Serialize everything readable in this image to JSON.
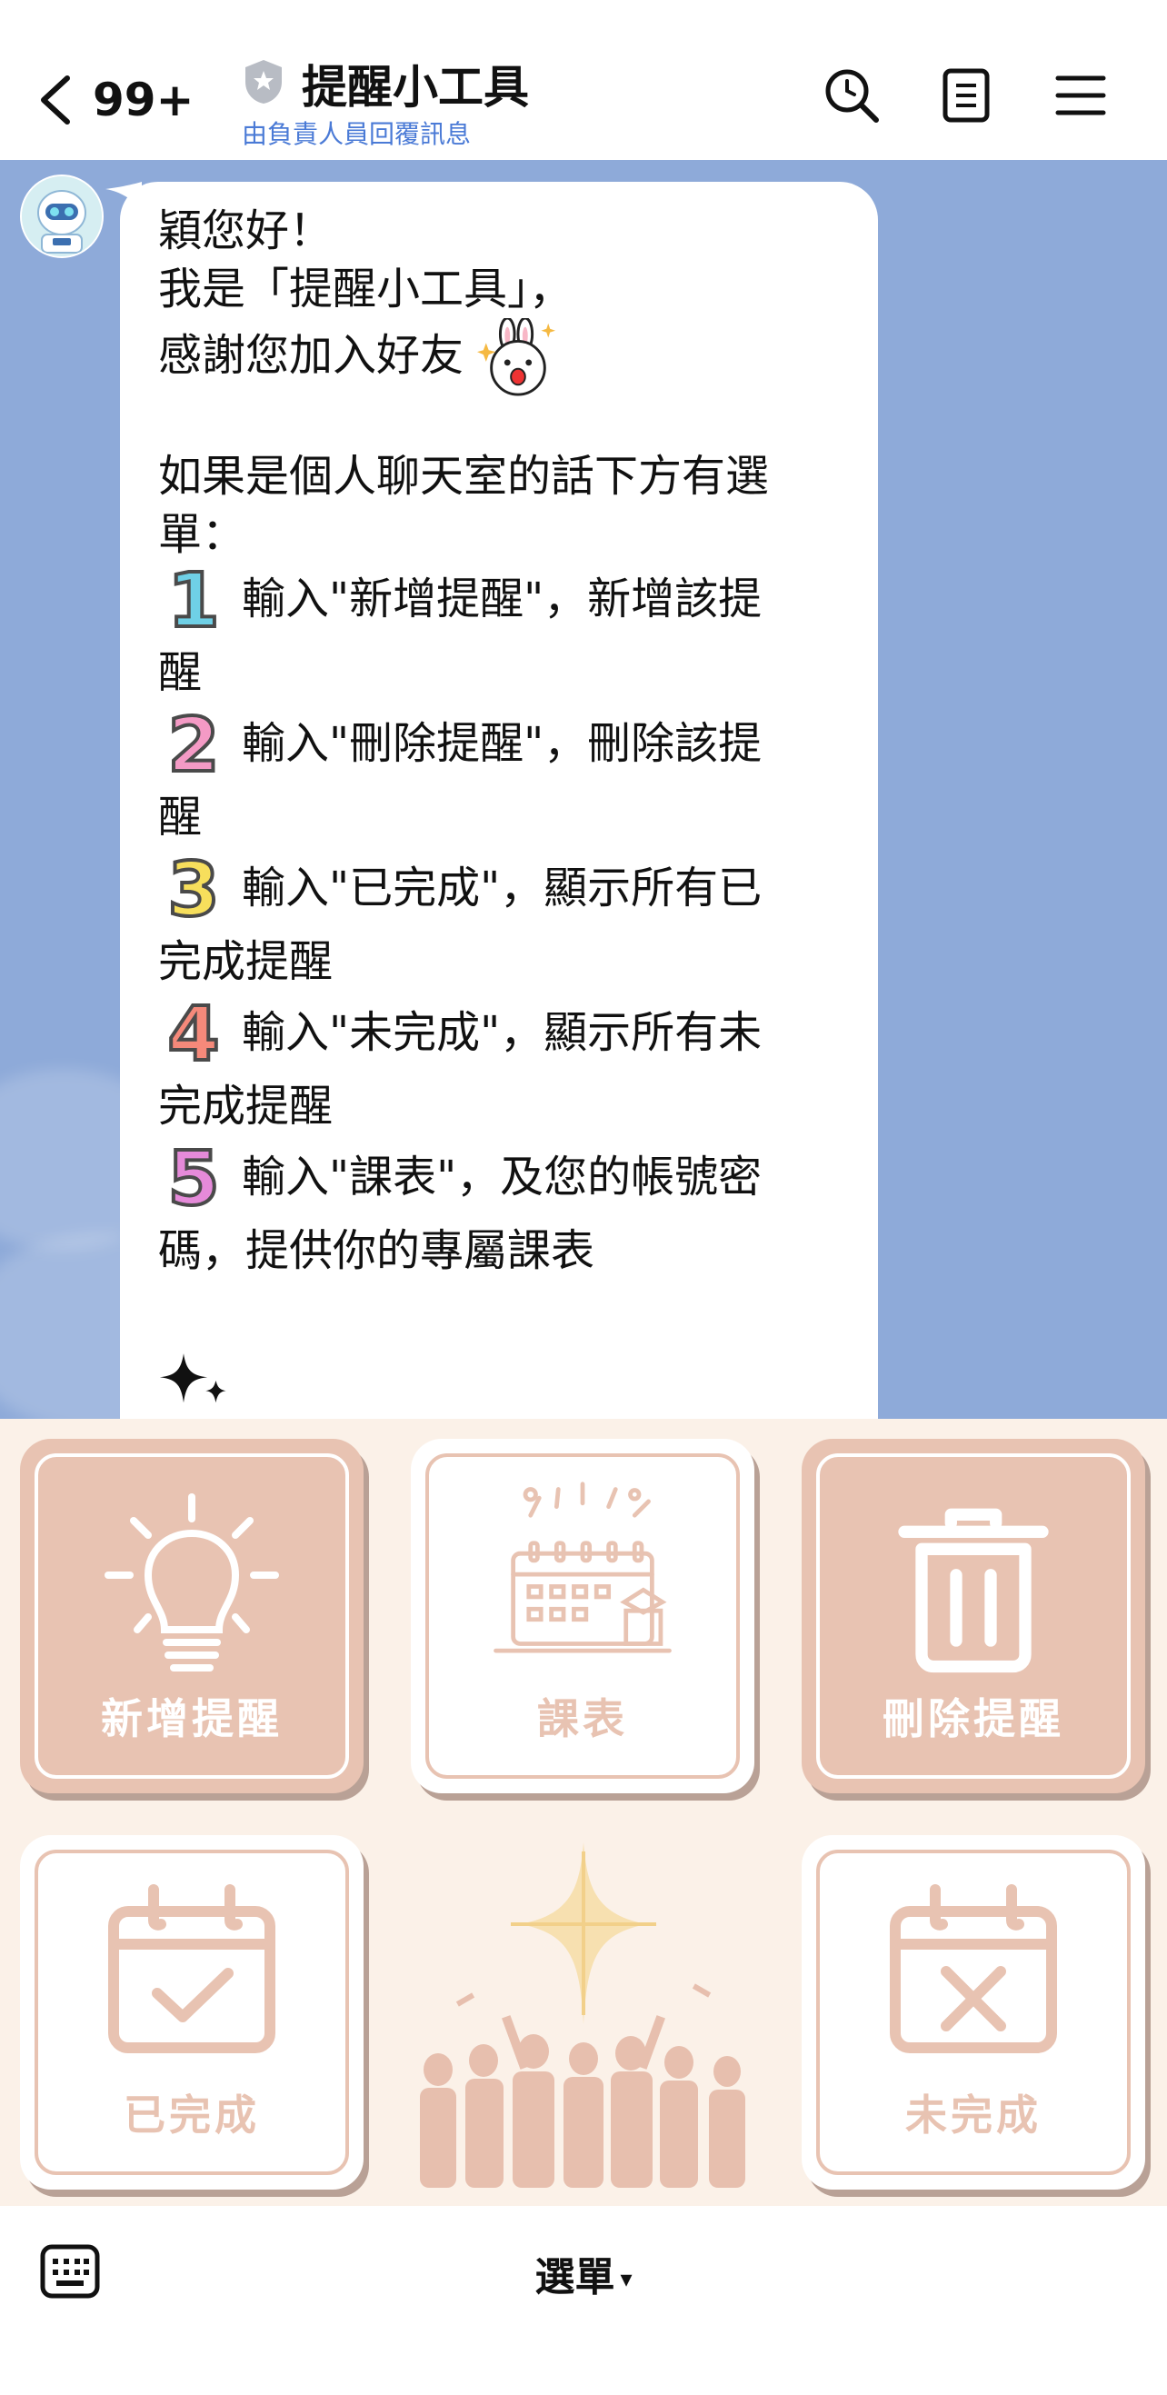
{
  "header": {
    "unread_count": "99+",
    "title": "提醒小工具",
    "subtitle": "由負責人員回覆訊息",
    "icons": [
      "back-chevron-icon",
      "shield-icon",
      "search-icon",
      "notes-icon",
      "menu-icon"
    ]
  },
  "message": {
    "greeting": "穎您好！",
    "intro": "我是「提醒小工具」，",
    "thanks": "感謝您加入好友",
    "menu_intro_1": "如果是個人聊天室的話下方有選",
    "menu_intro_2": "單：",
    "items": [
      {
        "num": "1",
        "color": "#6fd0e6",
        "line1": "輸入\"新增提醒\"，新增該提",
        "line2": "醒"
      },
      {
        "num": "2",
        "color": "#f49ac5",
        "line1": "輸入\"刪除提醒\"，刪除該提",
        "line2": "醒"
      },
      {
        "num": "3",
        "color": "#f7df5c",
        "line1": "輸入\"已完成\"，顯示所有已",
        "line2": "完成提醒"
      },
      {
        "num": "4",
        "color": "#f5897a",
        "line1": "輸入\"未完成\"，顯示所有未",
        "line2": "完成提醒"
      },
      {
        "num": "5",
        "color": "#e58ad9",
        "line1": "輸入\"課表\"，及您的帳號密",
        "line2": "碼，提供你的專屬課表"
      }
    ]
  },
  "rich_menu": {
    "tiles": [
      {
        "label": "新增提醒",
        "icon": "lightbulb-icon",
        "style": "filled"
      },
      {
        "label": "課表",
        "icon": "calendar-celebration-icon",
        "style": "light"
      },
      {
        "label": "刪除提醒",
        "icon": "trash-icon",
        "style": "filled"
      },
      {
        "label": "已完成",
        "icon": "calendar-check-icon",
        "style": "light"
      },
      {
        "label": "未完成",
        "icon": "calendar-x-icon",
        "style": "light"
      }
    ],
    "decoration": "graduates-silhouette-star"
  },
  "bottom_bar": {
    "menu_label": "選單",
    "caret": "▾"
  },
  "colors": {
    "chat_bg": "#8eaad9",
    "menu_bg": "#fbf1e8",
    "tile_accent": "#e8c3b2",
    "link_blue": "#4a7ad6"
  }
}
